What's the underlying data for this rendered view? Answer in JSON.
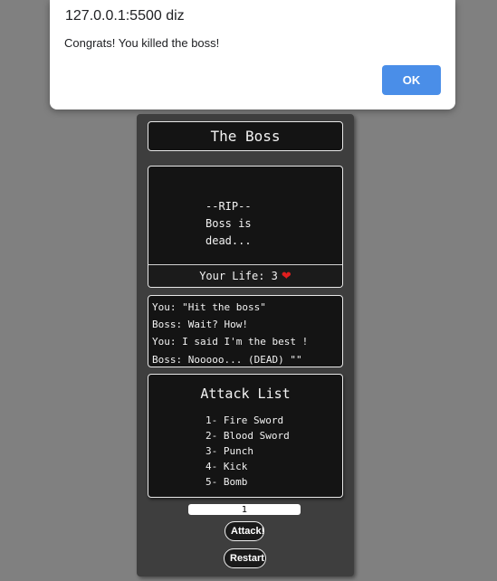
{
  "alert": {
    "origin": "127.0.0.1:5500 diz",
    "message": "Congrats! You killed the boss!",
    "ok_label": "OK"
  },
  "game": {
    "title": "The Boss",
    "boss_screen": {
      "message": "--RIP--\nBoss is\ndead..."
    },
    "life": {
      "label": "Your Life: 3",
      "heart_icon": "heart-icon",
      "heart_color": "#e01e1e"
    },
    "dialog": [
      "You: \"Hit the boss\"",
      "Boss: Wait? How!",
      "You: I said I'm the best !",
      "Boss: Nooooo... (DEAD) \"\""
    ],
    "attack_list": {
      "title": "Attack List",
      "items": [
        "1- Fire Sword",
        "2- Blood Sword",
        "3- Punch",
        "4- Kick",
        "5- Bomb"
      ]
    },
    "attack_input_value": "1",
    "attack_button_label": "Attack!",
    "restart_button_label": "Restart"
  }
}
